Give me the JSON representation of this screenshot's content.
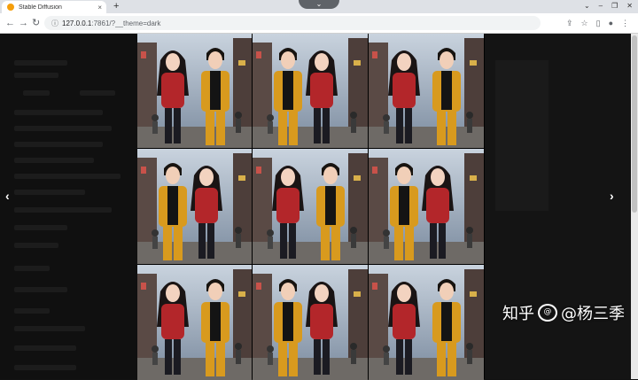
{
  "browser": {
    "tab_title": "Stable Diffusion",
    "url_host": "127.0.0.1",
    "url_rest": ":7861/?__theme=dark",
    "new_tab": "+",
    "tab_close": "×"
  },
  "viewer": {
    "prev_arrow": "‹",
    "next_arrow": "›",
    "images": [
      {
        "label": "image-1"
      },
      {
        "label": "image-2"
      },
      {
        "label": "image-3"
      },
      {
        "label": "image-4"
      },
      {
        "label": "image-5"
      },
      {
        "label": "image-6"
      },
      {
        "label": "image-7"
      },
      {
        "label": "image-8"
      },
      {
        "label": "image-9"
      }
    ]
  },
  "watermark": {
    "site": "知乎",
    "author": "@杨三季"
  },
  "colors": {
    "mustard_jacket": "#d89a1e",
    "red_sweater": "#b3262a",
    "street_bg": "#7a8a9e"
  }
}
